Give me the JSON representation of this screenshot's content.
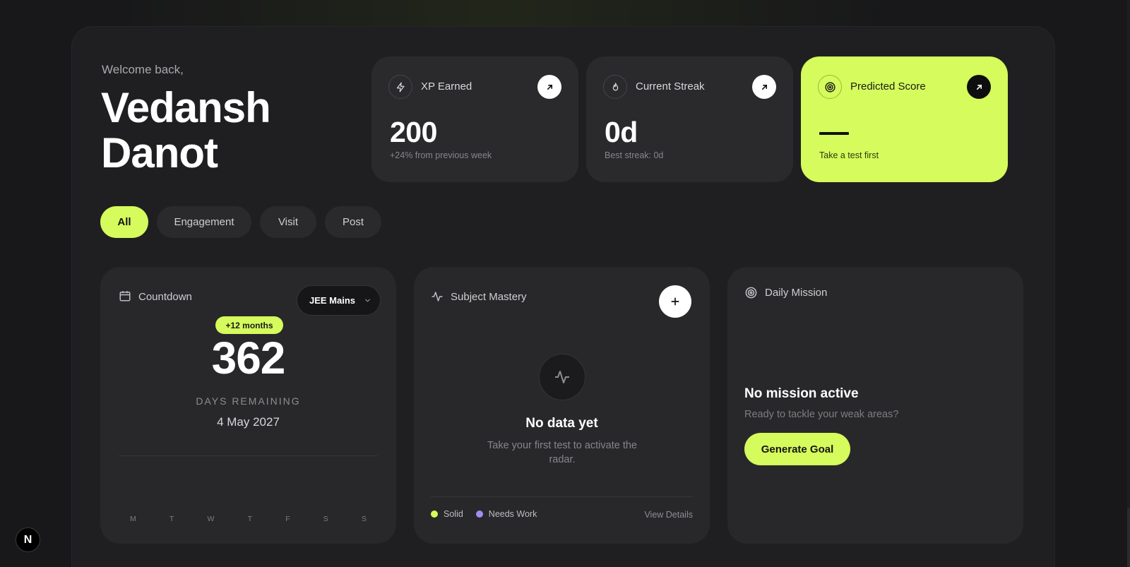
{
  "header": {
    "greeting": "Welcome back,",
    "user_name": "Vedansh Danot"
  },
  "stats": [
    {
      "label": "XP Earned",
      "value": "200",
      "sub": "+24% from previous week",
      "icon": "lightning-icon"
    },
    {
      "label": "Current Streak",
      "value": "0d",
      "sub": "Best streak: 0d",
      "icon": "flame-icon"
    },
    {
      "label": "Predicted Score",
      "value": "—",
      "sub": "Take a test first",
      "icon": "target-icon"
    }
  ],
  "filters": [
    {
      "label": "All",
      "active": true
    },
    {
      "label": "Engagement",
      "active": false
    },
    {
      "label": "Visit",
      "active": false
    },
    {
      "label": "Post",
      "active": false
    }
  ],
  "countdown": {
    "title": "Countdown",
    "exam_select": "JEE Mains",
    "badge": "+12 months",
    "days": "362",
    "days_label": "DAYS REMAINING",
    "date": "4 May 2027",
    "weekdays": [
      "M",
      "T",
      "W",
      "T",
      "F",
      "S",
      "S"
    ]
  },
  "mastery": {
    "title": "Subject Mastery",
    "empty_title": "No data yet",
    "empty_sub": "Take your first test to activate the radar.",
    "legend": [
      {
        "label": "Solid",
        "color": "#d5fb5c"
      },
      {
        "label": "Needs Work",
        "color": "#a58cf0"
      }
    ],
    "view_details": "View Details"
  },
  "mission": {
    "title": "Daily Mission",
    "empty_title": "No mission active",
    "empty_sub": "Ready to tackle your weak areas?",
    "button": "Generate Goal"
  },
  "badge_logo": "N",
  "colors": {
    "accent": "#d5fb5c",
    "background": "#18181a",
    "card": "#28282b"
  }
}
